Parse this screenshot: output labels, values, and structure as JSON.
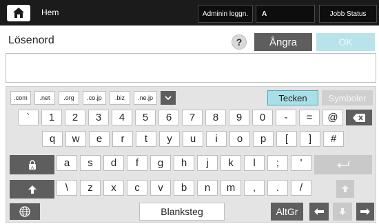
{
  "topbar": {
    "home_label": "Hem",
    "admin_login": "Adminin loggn.",
    "user_indicator": "A",
    "job_status": "Jobb Status"
  },
  "password": {
    "label": "Lösenord",
    "help": "?",
    "undo": "Ångra",
    "ok": "OK",
    "value": ""
  },
  "domains": [
    ".com",
    ".net",
    ".org",
    ".co.jp",
    ".biz",
    ".ne.jp"
  ],
  "mode": {
    "tecken": "Tecken",
    "symboler": "Symboler"
  },
  "rows": {
    "row1": [
      "`",
      "1",
      "2",
      "3",
      "4",
      "5",
      "6",
      "7",
      "8",
      "9",
      "0",
      "-",
      "=",
      "@"
    ],
    "row2": [
      "q",
      "w",
      "e",
      "r",
      "t",
      "y",
      "u",
      "i",
      "o",
      "p",
      "[",
      "]",
      "#"
    ],
    "row3": [
      "a",
      "s",
      "d",
      "f",
      "g",
      "h",
      "j",
      "k",
      "l",
      ";",
      "'"
    ],
    "row4": [
      "\\",
      "z",
      "x",
      "c",
      "v",
      "b",
      "n",
      "m",
      ",",
      ".",
      "/"
    ]
  },
  "bottom": {
    "space": "Blanksteg",
    "altgr": "AltGr"
  },
  "colors": {
    "accent": "#a9dfe6",
    "dark": "#5e5e5e",
    "topbar": "#1b1b1b"
  }
}
